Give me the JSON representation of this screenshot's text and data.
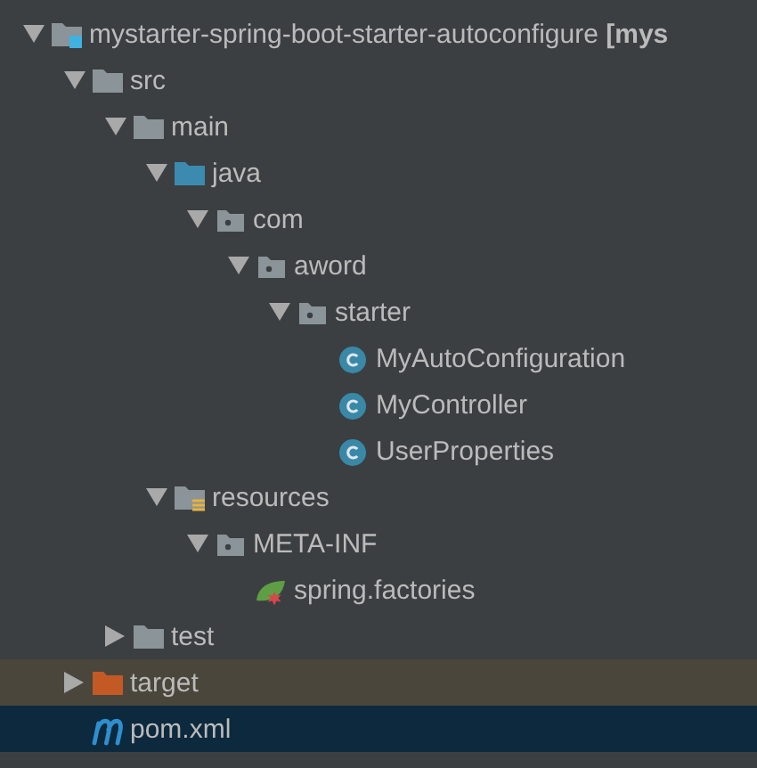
{
  "tree": [
    {
      "kind": "module",
      "label": "mystarter-spring-boot-starter-autoconfigure **[mys**",
      "expanded": true,
      "selected": false,
      "highlighted": false,
      "children": [
        {
          "kind": "folder",
          "label": "src",
          "expanded": true,
          "selected": false,
          "highlighted": false,
          "children": [
            {
              "kind": "folder",
              "label": "main",
              "expanded": true,
              "selected": false,
              "highlighted": false,
              "children": [
                {
                  "kind": "source-folder",
                  "label": "java",
                  "expanded": true,
                  "selected": false,
                  "highlighted": false,
                  "children": [
                    {
                      "kind": "package",
                      "label": "com",
                      "expanded": true,
                      "selected": false,
                      "highlighted": false,
                      "children": [
                        {
                          "kind": "package",
                          "label": "aword",
                          "expanded": true,
                          "selected": false,
                          "highlighted": false,
                          "children": [
                            {
                              "kind": "package",
                              "label": "starter",
                              "expanded": true,
                              "selected": false,
                              "highlighted": false,
                              "children": [
                                {
                                  "kind": "class",
                                  "label": "MyAutoConfiguration",
                                  "selected": false,
                                  "highlighted": false
                                },
                                {
                                  "kind": "class",
                                  "label": "MyController",
                                  "selected": false,
                                  "highlighted": false
                                },
                                {
                                  "kind": "class",
                                  "label": "UserProperties",
                                  "selected": false,
                                  "highlighted": false
                                }
                              ]
                            }
                          ]
                        }
                      ]
                    }
                  ]
                },
                {
                  "kind": "resource-folder",
                  "label": "resources",
                  "expanded": true,
                  "selected": false,
                  "highlighted": false,
                  "children": [
                    {
                      "kind": "package",
                      "label": "META-INF",
                      "expanded": true,
                      "selected": false,
                      "highlighted": false,
                      "children": [
                        {
                          "kind": "spring-file",
                          "label": "spring.factories",
                          "selected": false,
                          "highlighted": false
                        }
                      ]
                    }
                  ]
                }
              ]
            },
            {
              "kind": "folder",
              "label": "test",
              "expanded": false,
              "selected": false,
              "highlighted": false
            }
          ]
        },
        {
          "kind": "excluded-folder",
          "label": "target",
          "expanded": false,
          "selected": false,
          "highlighted": true
        },
        {
          "kind": "maven-file",
          "label": "pom.xml",
          "selected": true,
          "highlighted": false
        }
      ]
    }
  ]
}
